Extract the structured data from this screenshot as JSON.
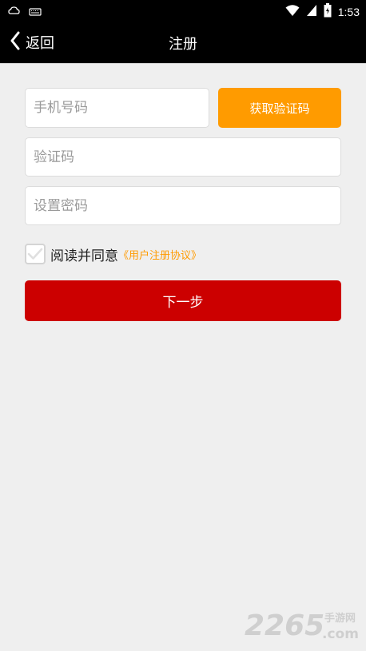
{
  "status_bar": {
    "time": "1:53",
    "icons": [
      "notification-icon",
      "keyboard-icon",
      "wifi-icon",
      "signal-icon",
      "battery-icon"
    ]
  },
  "header": {
    "back_label": "返回",
    "title": "注册"
  },
  "form": {
    "phone_placeholder": "手机号码",
    "get_code_label": "获取验证码",
    "code_placeholder": "验证码",
    "password_placeholder": "设置密码",
    "agree_text": "阅读并同意",
    "agreement_link": "《用户注册协议》",
    "agree_checked": true,
    "next_label": "下一步"
  },
  "watermark": {
    "brand": "2265",
    "site": "手游网",
    "domain": ".com"
  },
  "colors": {
    "status_bar": "#000000",
    "title_bar": "#000000",
    "background": "#efefef",
    "accent_orange": "#ff9b00",
    "primary_red": "#cc0000"
  }
}
